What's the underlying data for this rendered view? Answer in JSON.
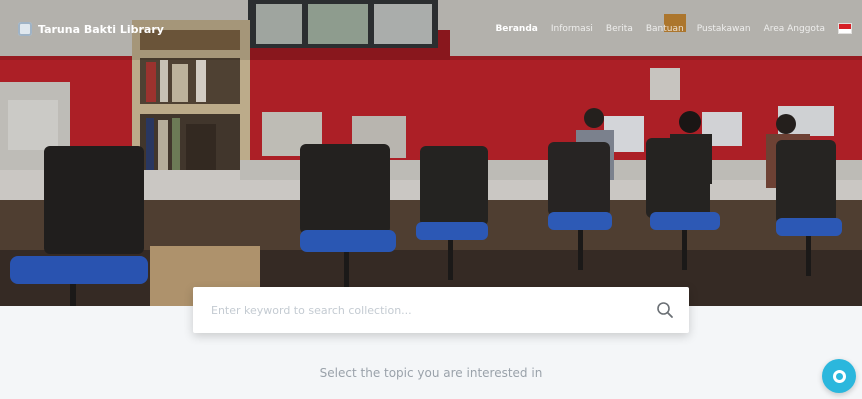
{
  "header": {
    "brand": "Taruna Bakti Library",
    "nav": [
      {
        "label": "Beranda",
        "active": true
      },
      {
        "label": "Informasi",
        "active": false
      },
      {
        "label": "Berita",
        "active": false
      },
      {
        "label": "Bantuan",
        "active": false
      },
      {
        "label": "Pustakawan",
        "active": false
      },
      {
        "label": "Area Anggota",
        "active": false
      }
    ],
    "language_icon": "indonesia-flag-icon"
  },
  "search": {
    "placeholder": "Enter keyword to search collection...",
    "value": "",
    "icon": "search-icon"
  },
  "main": {
    "topic_heading": "Select the topic you are interested in"
  },
  "chat": {
    "icon": "chat-bubble-icon",
    "color": "#2bb7dd"
  },
  "colors": {
    "accent": "#2bb7dd",
    "wall": "#c8242b",
    "chair_seat": "#2f5fc9"
  }
}
